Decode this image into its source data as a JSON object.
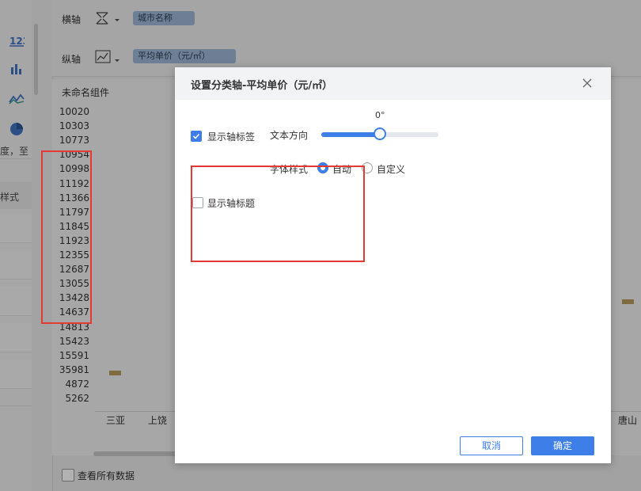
{
  "topbar": {
    "x_axis_label": "横轴",
    "x_axis_field": "城市名称",
    "y_axis_label": "纵轴",
    "y_axis_field": "平均单价（元/㎡）"
  },
  "left_rail": {
    "cut_text_1": "度，至",
    "cut_text_2": "样式"
  },
  "chart": {
    "component_name": "未命名组件",
    "y_labels": [
      "10020",
      "10303",
      "10773",
      "10954",
      "10998",
      "11192",
      "11366",
      "11797",
      "11845",
      "11923",
      "12355",
      "12687",
      "13055",
      "13428",
      "14637",
      "14813",
      "15423",
      "15591",
      "35981",
      "4872",
      "5262"
    ],
    "x_labels": [
      "三亚",
      "上饶",
      "唐山"
    ],
    "view_all_label": "查看所有数据"
  },
  "dialog": {
    "title": "设置分类轴-平均单价（元/㎡）",
    "show_axis_labels": {
      "label": "显示轴标签",
      "checked": true
    },
    "text_direction": {
      "label": "文本方向",
      "value_text": "0°",
      "value": 0
    },
    "font_style": {
      "label": "字体样式",
      "options": [
        {
          "label": "自动",
          "selected": true
        },
        {
          "label": "自定义",
          "selected": false
        }
      ]
    },
    "show_axis_title": {
      "label": "显示轴标题",
      "checked": false
    },
    "cancel_label": "取消",
    "ok_label": "确定"
  },
  "colors": {
    "accent": "#3d7ee8",
    "highlight_box": "#e53935",
    "bar": "#7e6b3e"
  }
}
